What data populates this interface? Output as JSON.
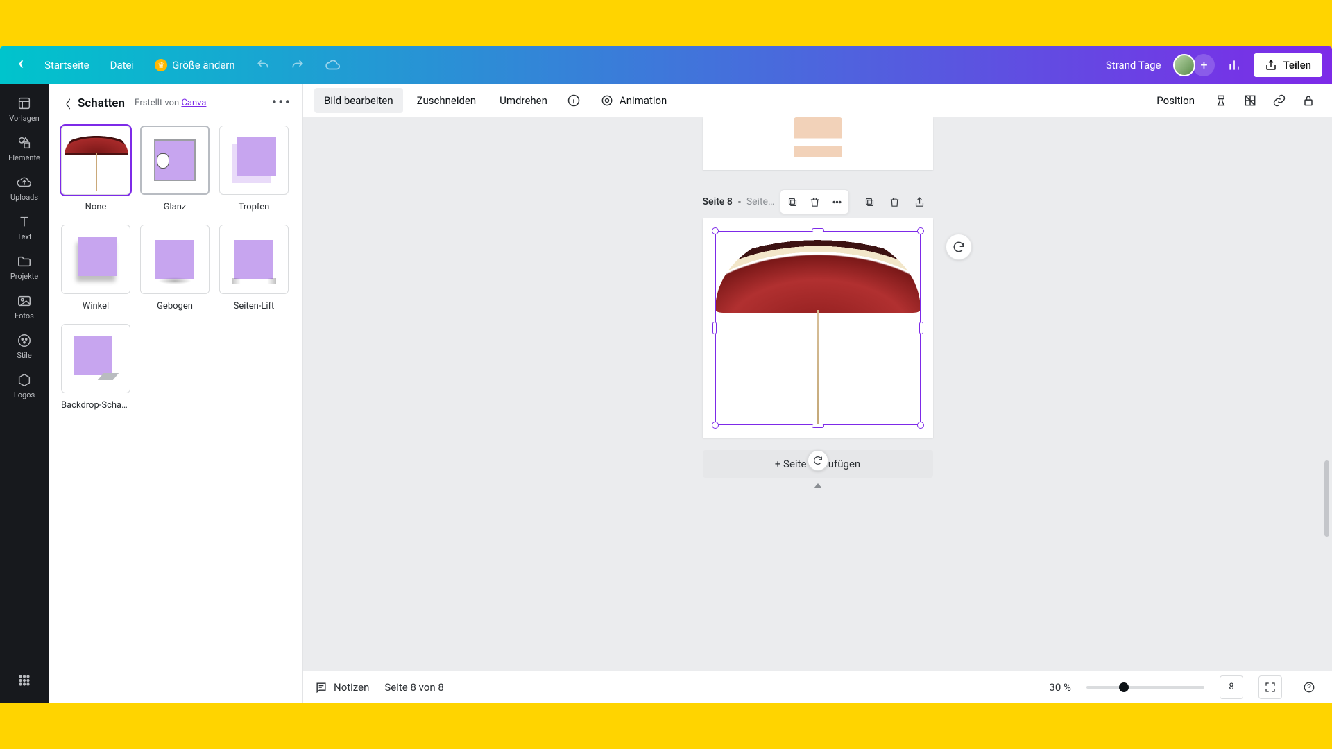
{
  "topbar": {
    "home": "Startseite",
    "file": "Datei",
    "resize": "Größe ändern",
    "project_name": "Strand Tage",
    "share": "Teilen"
  },
  "rail": {
    "templates": "Vorlagen",
    "elements": "Elemente",
    "uploads": "Uploads",
    "text": "Text",
    "projects": "Projekte",
    "photos": "Fotos",
    "styles": "Stile",
    "logos": "Logos"
  },
  "panel": {
    "title": "Schatten",
    "created_by_prefix": "Erstellt von ",
    "created_by_link": "Canva",
    "items": [
      {
        "id": "none",
        "name": "None",
        "selected": true,
        "hovered": false,
        "fx": "none-thumb"
      },
      {
        "id": "glanz",
        "name": "Glanz",
        "selected": false,
        "hovered": true,
        "fx": "fx-glanz"
      },
      {
        "id": "tropfen",
        "name": "Tropfen",
        "selected": false,
        "hovered": false,
        "fx": "fx-tropfen"
      },
      {
        "id": "winkel",
        "name": "Winkel",
        "selected": false,
        "hovered": false,
        "fx": "fx-winkel"
      },
      {
        "id": "gebogen",
        "name": "Gebogen",
        "selected": false,
        "hovered": false,
        "fx": "fx-gebogen"
      },
      {
        "id": "seiten",
        "name": "Seiten-Lift",
        "selected": false,
        "hovered": false,
        "fx": "fx-seiten"
      },
      {
        "id": "backdrop",
        "name": "Backdrop-Schatt…",
        "selected": false,
        "hovered": false,
        "fx": "fx-backdrop"
      }
    ]
  },
  "context": {
    "edit_image": "Bild bearbeiten",
    "crop": "Zuschneiden",
    "flip": "Umdrehen",
    "animation": "Animation",
    "position": "Position"
  },
  "canvas": {
    "page_label_strong": "Seite 8",
    "page_label_sep": " - ",
    "page_label_muted": "Seite…",
    "add_page": "+ Seite hinzufügen"
  },
  "status": {
    "notes": "Notizen",
    "page_of": "Seite 8 von 8",
    "zoom": "30 %",
    "page_badge": "8"
  }
}
